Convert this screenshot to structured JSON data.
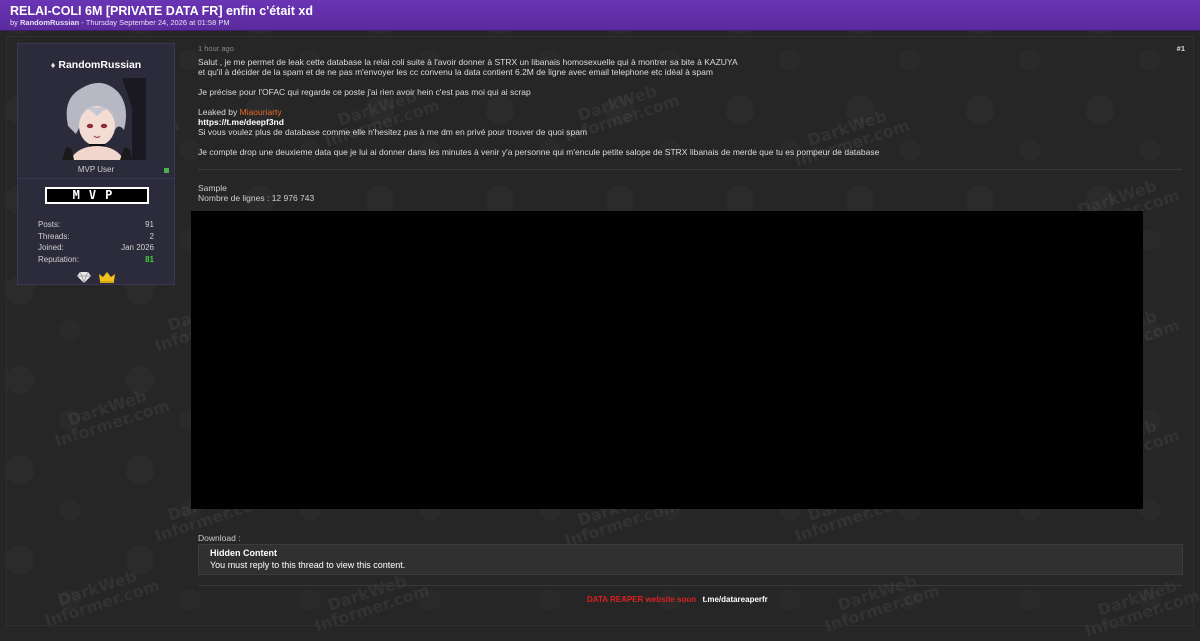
{
  "thread": {
    "title": "RELAI-COLI 6M [PRIVATE DATA FR] enfin c'était xd",
    "byline_prefix": "by",
    "author": "RandomRussian",
    "byline_rest": "- Thursday September 24, 2026 at 01:58 PM"
  },
  "watermark": {
    "line1": "DarkWeb",
    "line2": "Informer.com"
  },
  "profile": {
    "username": "RandomRussian",
    "user_title": "MVP User",
    "rank_badge": "MVP",
    "stats": [
      {
        "label": "Posts:",
        "value": "91"
      },
      {
        "label": "Threads:",
        "value": "2"
      },
      {
        "label": "Joined:",
        "value": "Jan 2026"
      },
      {
        "label": "Reputation:",
        "value": "81"
      }
    ],
    "badge_icons": [
      "diamond-icon",
      "crown-icon"
    ]
  },
  "post": {
    "time": "1 hour ago",
    "number": "#1",
    "p1_line1": "Salut , je me permet de leak cette database la relai coli suite à l'avoir donner à STRX un libanais homosexuelle qui à montrer sa bite à KAZUYA",
    "p1_line2": "et qu'il à décider de la spam et de ne pas m'envoyer les cc convenu la data contient 6.2M de ligne avec email telephone etc idéal à spam",
    "p2": "Je précise pour l'OFAC qui regarde ce poste j'ai rien avoir hein c'est pas moi qui ai scrap",
    "leaked_by_label": "Leaked by",
    "leaked_by_name": "Miaouriarty",
    "tg_link": "https://t.me/deepf3nd",
    "p3": "Si vous voulez plus de database comme elle n'hesitez pas à me dm en privé pour trouver de quoi spam",
    "p4": "Je compte drop une deuxieme data que je lui ai donner dans les minutes à venir y'a personne qui m'encule petite salope de STRX libanais de merde que tu es pompeur de database",
    "sample_label": "Sample",
    "line_count": "Nombre de lignes : 12 976 743",
    "download_label": "Download :",
    "hidden_title": "Hidden Content",
    "hidden_desc": "You must reply to this thread to view this content."
  },
  "footer": {
    "red_text": "DATA REAPER website soon",
    "link": "t.me/datareaperfr"
  },
  "colors": {
    "header_bg": "#5f2ea6",
    "page_bg": "#262626",
    "profile_bg": "#2c2b3b",
    "mention": "#e56a29",
    "reputation": "#44d144",
    "footer_red": "#e01f1f"
  }
}
